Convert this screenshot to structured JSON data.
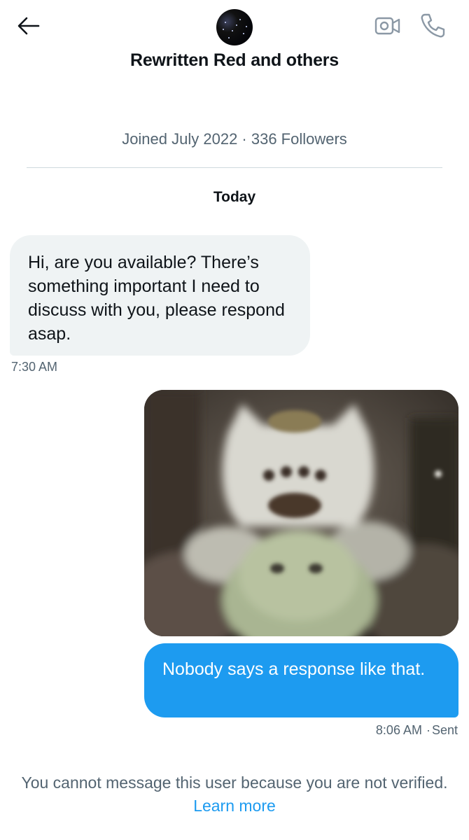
{
  "header": {
    "title": "Rewritten Red and others",
    "meta": "Joined July 2022 · 336 Followers"
  },
  "conversation": {
    "day_label": "Today",
    "messages": [
      {
        "direction": "incoming",
        "text": "Hi, are you available? There’s something important I need to discuss with you, please respond asap.",
        "time": "7:30 AM"
      },
      {
        "direction": "outgoing",
        "type": "image",
        "image_description": "blurry cat wearing a white helmet"
      },
      {
        "direction": "outgoing",
        "text": "Nobody says a response like that.",
        "time": "8:06 AM",
        "status": "Sent"
      }
    ]
  },
  "footer": {
    "notice_text": "You cannot message this user because you are not verified.",
    "learn_more": "Learn more"
  },
  "icons": {
    "back": "arrow-left-icon",
    "video": "video-camera-icon",
    "call": "phone-icon"
  },
  "colors": {
    "accent": "#1d9bf0",
    "incoming_bubble": "#eff3f4",
    "secondary_text": "#536471"
  }
}
